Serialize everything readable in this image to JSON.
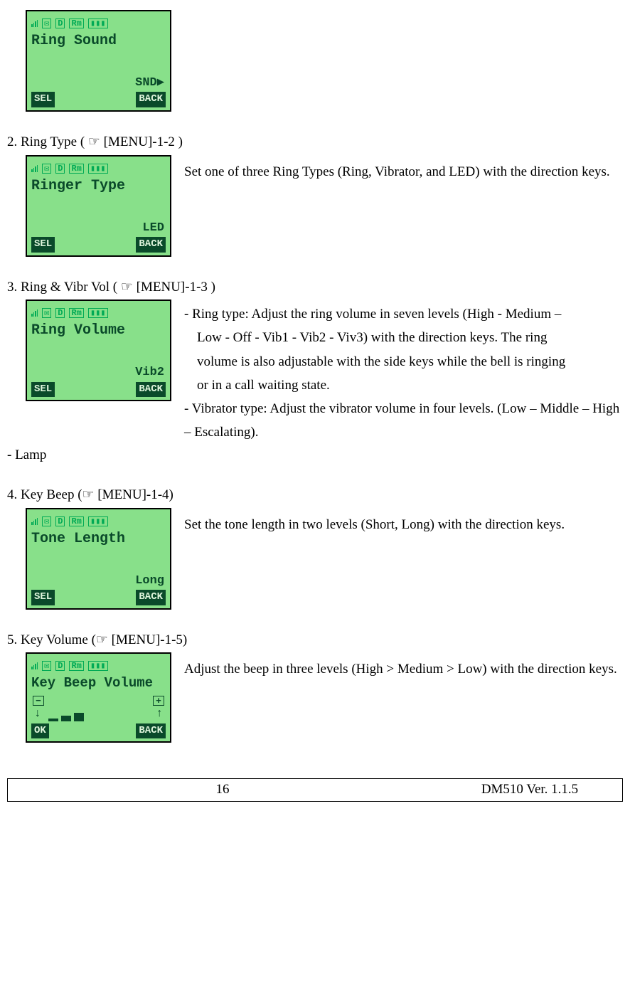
{
  "lcd1": {
    "title": "Ring Sound",
    "value": "SND▶",
    "left_btn": "SEL",
    "right_btn": "BACK"
  },
  "sec2": {
    "heading": "2.    Ring Type ( ☞ [MENU]-1-2 )",
    "desc": "Set one of three Ring Types (Ring, Vibrator, and LED) with the direction keys.",
    "lcd": {
      "title": "Ringer Type",
      "value": "LED",
      "left_btn": "SEL",
      "right_btn": "BACK"
    }
  },
  "sec3": {
    "heading": "3.    Ring & Vibr Vol ( ☞ [MENU]-1-3 )",
    "line1": "- Ring type: Adjust the ring volume in seven levels (High - Medium –",
    "line1b": "Low - Off - Vib1 - Vib2 - Viv3) with the direction keys. The ring",
    "line1c": "volume is also adjustable with the side keys while the bell is ringing",
    "line1d": "or in a call waiting state.",
    "line2": "- Vibrator type: Adjust the vibrator volume in four levels. (Low – Middle – High – Escalating).",
    "extra": "- Lamp",
    "lcd": {
      "title": "Ring Volume",
      "value": "Vib2",
      "left_btn": "SEL",
      "right_btn": "BACK"
    }
  },
  "sec4": {
    "heading": "4. Key Beep    (☞ [MENU]-1-4)",
    "desc": "Set the tone length in two levels (Short, Long) with the direction keys.",
    "lcd": {
      "title": "Tone Length",
      "value": "Long",
      "left_btn": "SEL",
      "right_btn": "BACK"
    }
  },
  "sec5": {
    "heading": "5. Key Volume (☞ [MENU]-1-5)",
    "desc": "Adjust the beep in three levels (High > Medium > Low) with the direction keys.",
    "lcd": {
      "title": "Key Beep Volume",
      "minus": "−",
      "plus": "+",
      "left_btn": "OK",
      "right_btn": "BACK"
    }
  },
  "footer": {
    "page": "16",
    "version": "DM510    Ver. 1.1.5"
  }
}
